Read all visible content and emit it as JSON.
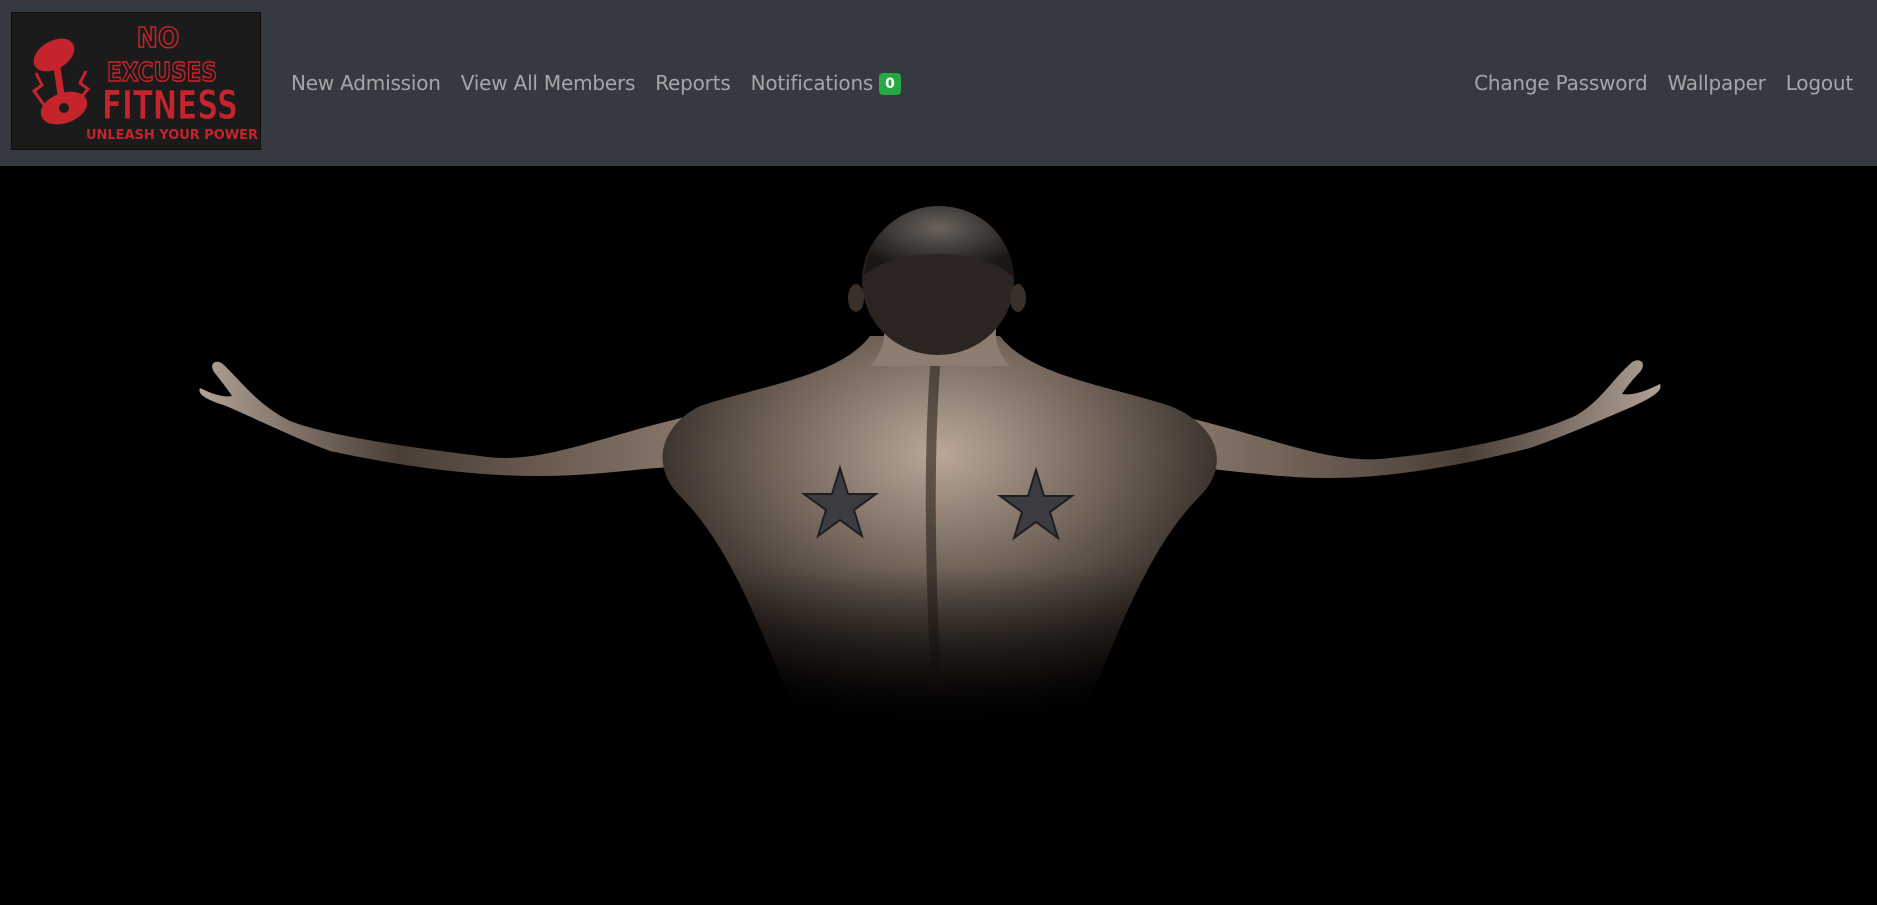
{
  "brand": {
    "logo_line1": "NO",
    "logo_line2": "EXCUSES",
    "logo_line3": "FITNESS",
    "logo_tagline": "UNLEASH YOUR POWER",
    "accent_color": "#c4242b"
  },
  "nav": {
    "left_items": [
      {
        "label": "New Admission"
      },
      {
        "label": "View All Members"
      },
      {
        "label": "Reports"
      },
      {
        "label": "Notifications"
      }
    ],
    "notifications_count": "0",
    "badge_color": "#28a745",
    "right_items": [
      {
        "label": "Change Password"
      },
      {
        "label": "Wallpaper"
      },
      {
        "label": "Logout"
      }
    ]
  },
  "hero": {
    "background_color": "#000000",
    "subject": "muscular-back-photo"
  }
}
